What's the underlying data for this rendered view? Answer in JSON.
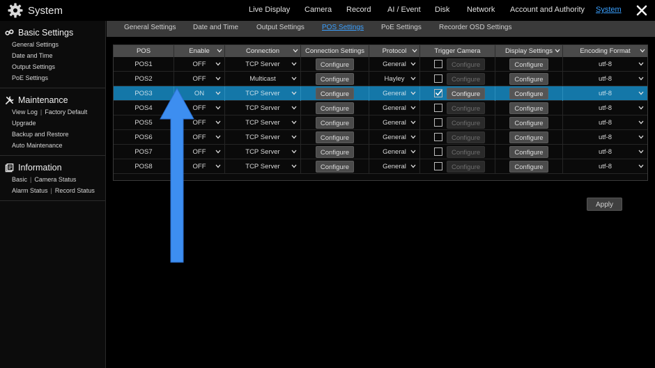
{
  "app": {
    "title": "System",
    "icon": "gear-icon"
  },
  "mainnav": {
    "items": [
      {
        "label": "Live Display"
      },
      {
        "label": "Camera"
      },
      {
        "label": "Record"
      },
      {
        "label": "AI / Event"
      },
      {
        "label": "Disk"
      },
      {
        "label": "Network"
      },
      {
        "label": "Account and Authority"
      },
      {
        "label": "System",
        "active": true
      }
    ]
  },
  "sidebar": {
    "groups": [
      {
        "title": "Basic Settings",
        "icon": "link-icon",
        "items": [
          "General Settings",
          "Date and Time",
          "Output Settings",
          "PoE Settings"
        ]
      },
      {
        "title": "Maintenance",
        "icon": "wrench-icon",
        "items": [
          [
            "View Log",
            "Factory Default"
          ],
          "Upgrade",
          "Backup and Restore",
          "Auto Maintenance"
        ]
      },
      {
        "title": "Information",
        "icon": "info-doc-icon",
        "items": [
          [
            "Basic",
            "Camera Status"
          ],
          [
            "Alarm Status",
            "Record Status"
          ]
        ]
      }
    ]
  },
  "subtabs": [
    "General Settings",
    "Date and Time",
    "Output Settings",
    "POS Settings",
    "PoE Settings",
    "Recorder OSD Settings"
  ],
  "active_subtab": "POS Settings",
  "table": {
    "headers": {
      "pos": "POS",
      "enable": "Enable",
      "connection": "Connection",
      "connection_settings": "Connection Settings",
      "protocol": "Protocol",
      "trigger_camera": "Trigger Camera",
      "display_settings": "Display Settings",
      "encoding_format": "Encoding Format"
    },
    "configure_label": "Configure",
    "rows": [
      {
        "pos": "POS1",
        "enable": "OFF",
        "connection": "TCP Server",
        "protocol": "General",
        "trigger": false,
        "encoding": "utf-8"
      },
      {
        "pos": "POS2",
        "enable": "OFF",
        "connection": "Multicast",
        "protocol": "Hayley",
        "trigger": false,
        "encoding": "utf-8"
      },
      {
        "pos": "POS3",
        "enable": "ON",
        "connection": "TCP Server",
        "protocol": "General",
        "trigger": true,
        "encoding": "utf-8",
        "selected": true
      },
      {
        "pos": "POS4",
        "enable": "OFF",
        "connection": "TCP Server",
        "protocol": "General",
        "trigger": false,
        "encoding": "utf-8"
      },
      {
        "pos": "POS5",
        "enable": "OFF",
        "connection": "TCP Server",
        "protocol": "General",
        "trigger": false,
        "encoding": "utf-8"
      },
      {
        "pos": "POS6",
        "enable": "OFF",
        "connection": "TCP Server",
        "protocol": "General",
        "trigger": false,
        "encoding": "utf-8"
      },
      {
        "pos": "POS7",
        "enable": "OFF",
        "connection": "TCP Server",
        "protocol": "General",
        "trigger": false,
        "encoding": "utf-8"
      },
      {
        "pos": "POS8",
        "enable": "OFF",
        "connection": "TCP Server",
        "protocol": "General",
        "trigger": false,
        "encoding": "utf-8"
      }
    ]
  },
  "apply_label": "Apply",
  "colors": {
    "accent": "#3aa0ff",
    "selected_row": "#1477a8",
    "annotation_arrow": "#3d8ef0"
  }
}
